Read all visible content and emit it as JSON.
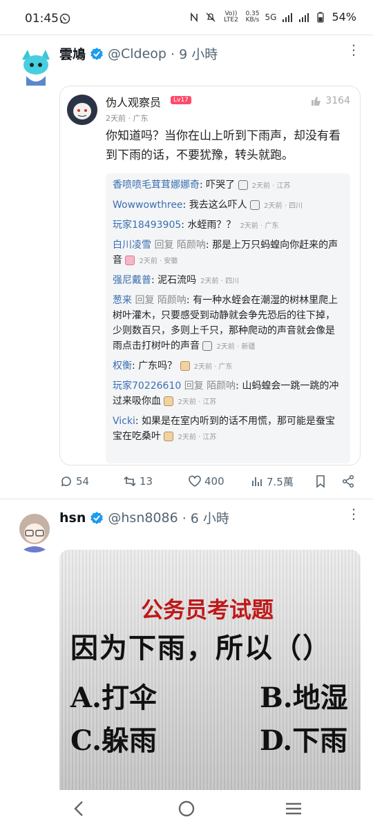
{
  "status_bar": {
    "time": "01:45",
    "volte": "Vo)) LTE2",
    "speed_value": "0.35",
    "speed_unit": "KB/s",
    "network": "5G",
    "battery": "54%"
  },
  "tweet1": {
    "display_name": "雲鳩",
    "handle": "@Cldeop",
    "time": "· 9 小時",
    "quoted_card": {
      "poster_name": "伪人观察员",
      "poster_level": "Lv17",
      "poster_meta": "2天前 · 广东",
      "likes": "3164",
      "body": "你知道吗？当你在山上听到下雨声，却没有看到下雨的话，不要犹豫，转头就跑。",
      "replies": [
        {
          "user": "香喷喷毛茸茸娜娜奇",
          "reply_word": "",
          "reply_to": "",
          "text": "吓哭了",
          "emoji": "white",
          "time": "2天前 · 江苏"
        },
        {
          "user": "Wowwowthree",
          "reply_word": "",
          "reply_to": "",
          "text": "我去这么吓人",
          "emoji": "white",
          "time": "2天前 · 四川"
        },
        {
          "user": "玩家18493905",
          "reply_word": "",
          "reply_to": "",
          "text": "水蛭雨？？",
          "emoji": "",
          "time": "2天前 · 广东"
        },
        {
          "user": "白川凌雪",
          "reply_word": "回复",
          "reply_to": "陌颜呐",
          "text": "那是上万只蚂蝗向你赶来的声音",
          "emoji": "pink",
          "time": "2天前 · 安徽"
        },
        {
          "user": "强尼戴普",
          "reply_word": "",
          "reply_to": "",
          "text": "泥石流吗",
          "emoji": "",
          "time": "2天前 · 四川"
        },
        {
          "user": "葱来",
          "reply_word": "回复",
          "reply_to": "陌颜呐",
          "text": "有一种水蛭会在潮湿的树林里爬上树叶灌木，只要感受到动静就会争先恐后的往下掉，少则数百只，多则上千只，那种爬动的声音就会像是雨点击打树叶的声音",
          "emoji": "white",
          "time": "2天前 · 新疆"
        },
        {
          "user": "权衡",
          "reply_word": "",
          "reply_to": "",
          "text": "广东吗？",
          "emoji": "tan",
          "time": "2天前 · 广东"
        },
        {
          "user": "玩家70226610",
          "reply_word": "回复",
          "reply_to": "陌颜呐",
          "text": "山蚂蝗会一跳一跳的冲过来吸你血",
          "emoji": "tan",
          "time": "2天前 · 江苏"
        },
        {
          "user": "Vicki",
          "reply_word": "",
          "reply_to": "",
          "text": "如果是在室内听到的话不用慌，那可能是蚕宝宝在吃桑叶",
          "emoji": "tan",
          "time": "2天前 · 江苏"
        }
      ]
    },
    "actions": {
      "replies": "54",
      "retweets": "13",
      "likes": "400",
      "views": "7.5萬"
    }
  },
  "tweet2": {
    "display_name": "hsn",
    "handle": "@hsn8086",
    "time": "· 6 小時",
    "image": {
      "title": "公务员考试题",
      "question": "因为下雨，所以（）",
      "options": [
        "A.打伞",
        "B.地湿",
        "C.躲雨",
        "D.下雨"
      ]
    }
  },
  "icons": {
    "verified_color": "#1d9bf0",
    "accent_color": "#3a6fb0"
  }
}
